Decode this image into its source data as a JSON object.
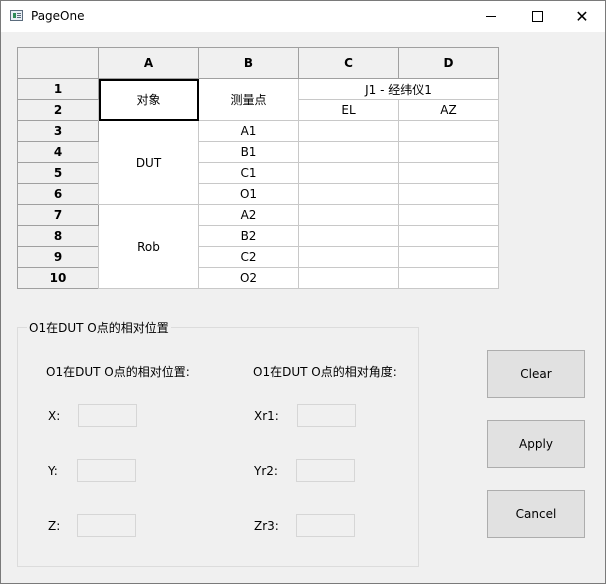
{
  "window": {
    "title": "PageOne",
    "minimize_label": "—",
    "close_label": "✕"
  },
  "grid": {
    "col_headers": [
      "A",
      "B",
      "C",
      "D"
    ],
    "row_headers": [
      "1",
      "2",
      "3",
      "4",
      "5",
      "6",
      "7",
      "8",
      "9",
      "10"
    ],
    "object_header": "对象",
    "point_header": "测量点",
    "instrument_header": "J1 - 经纬仪1",
    "el_header": "EL",
    "az_header": "AZ",
    "groups": [
      {
        "name": "DUT",
        "points": [
          "A1",
          "B1",
          "C1",
          "O1"
        ]
      },
      {
        "name": "Rob",
        "points": [
          "A2",
          "B2",
          "C2",
          "O2"
        ]
      }
    ]
  },
  "position_group": {
    "title": "O1在DUT O点的相对位置",
    "position_label": "O1在DUT O点的相对位置:",
    "angle_label": "O1在DUT O点的相对角度:",
    "x_label": "X:",
    "y_label": "Y:",
    "z_label": "Z:",
    "xr_label": "Xr1:",
    "yr_label": "Yr2:",
    "zr_label": "Zr3:",
    "x_value": "",
    "y_value": "",
    "z_value": "",
    "xr_value": "",
    "yr_value": "",
    "zr_value": ""
  },
  "buttons": {
    "clear": "Clear",
    "apply": "Apply",
    "cancel": "Cancel"
  }
}
